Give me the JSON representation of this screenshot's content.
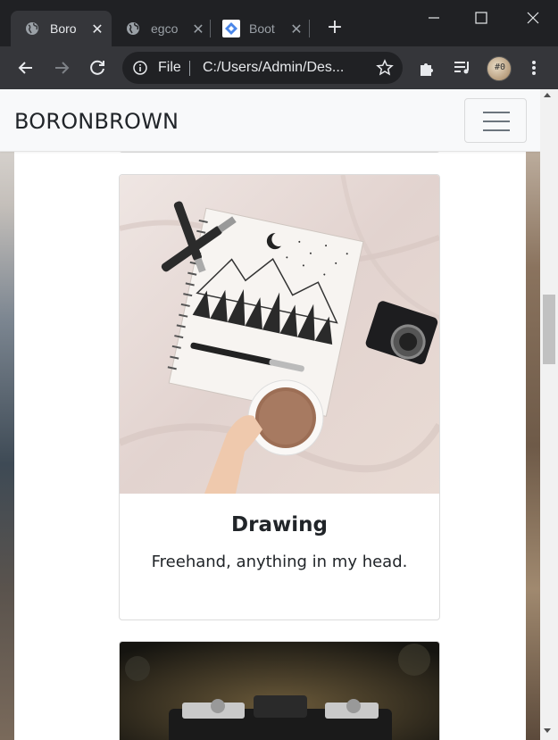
{
  "browser": {
    "tabs": [
      {
        "title": "Boro",
        "active": true
      },
      {
        "title": "egco",
        "active": false
      },
      {
        "title": "Boot",
        "active": false
      }
    ],
    "address": {
      "scheme_label": "File",
      "url": "C:/Users/Admin/Des..."
    },
    "colors": {
      "frame": "#202124",
      "toolbar": "#35363a",
      "active_tab": "#35363a"
    }
  },
  "page": {
    "brand": "BORONBROWN",
    "cards": [
      {
        "title": "Drawing",
        "text": "Freehand, anything in my head."
      }
    ]
  }
}
